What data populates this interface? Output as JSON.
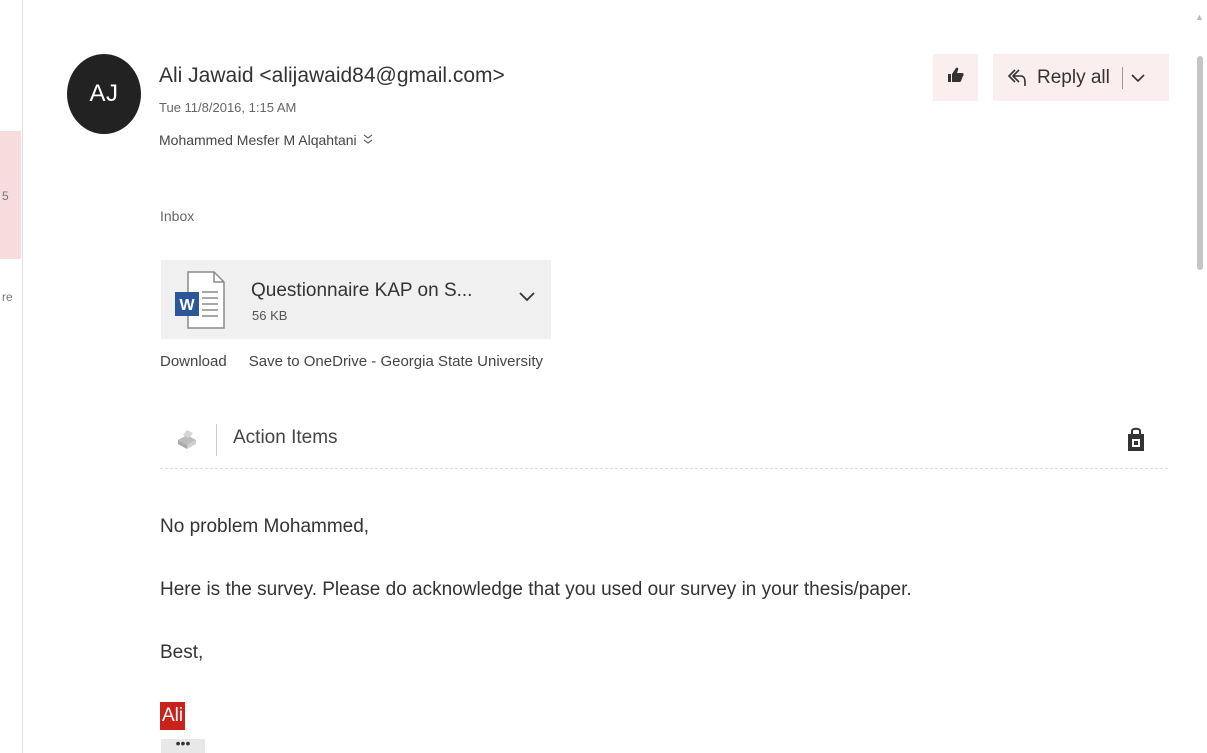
{
  "left_fragments": [
    "5",
    "re"
  ],
  "sender": {
    "avatar_initials": "AJ",
    "display": "Ali Jawaid <alijawaid84@gmail.com>",
    "date": "Tue 11/8/2016, 1:15 AM",
    "recipient": "Mohammed Mesfer M Alqahtani"
  },
  "folder": "Inbox",
  "toolbar": {
    "like_icon": "thumbs-up-icon",
    "reply_all_label": "Reply all"
  },
  "attachment": {
    "name": "Questionnaire KAP on S...",
    "size": "56 KB",
    "icon": "word-document-icon"
  },
  "attachment_actions": {
    "download": "Download",
    "save": "Save to OneDrive - Georgia State University"
  },
  "action_items": {
    "label": "Action Items"
  },
  "body": {
    "greeting": "No problem Mohammed,",
    "line1": "Here is the survey. Please do acknowledge that you used our survey in your thesis/paper.",
    "closing": "Best,",
    "signature": "Ali",
    "more": "•••"
  },
  "colors": {
    "accent_bg": "#fbeeee",
    "signature_bg": "#c8221a",
    "avatar_bg": "#222222"
  }
}
